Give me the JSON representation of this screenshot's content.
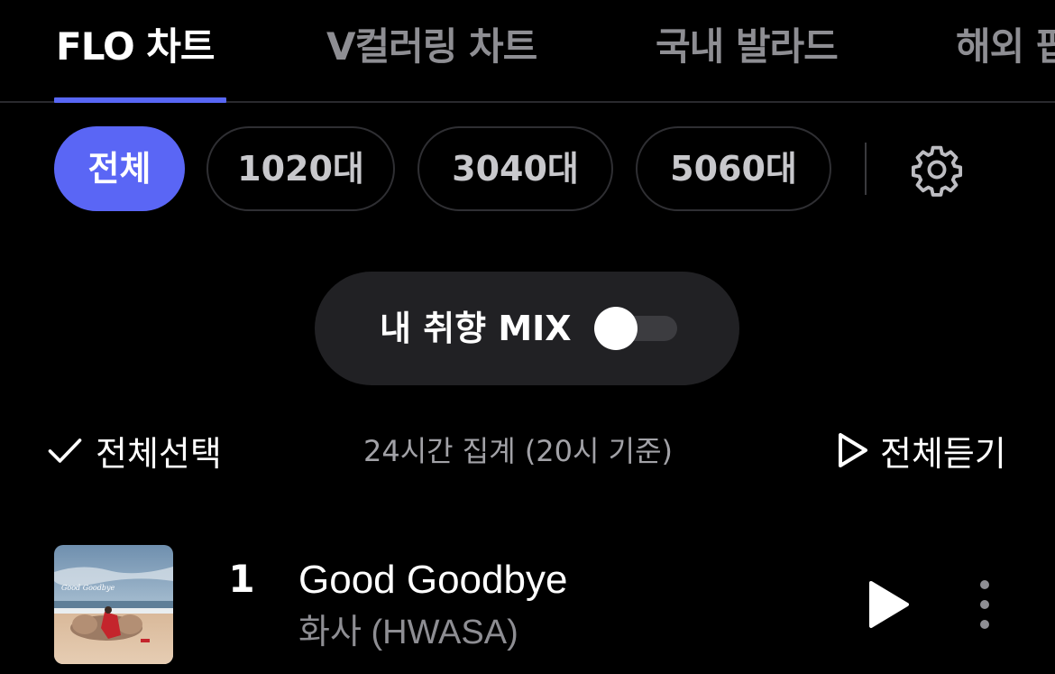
{
  "tabs": [
    {
      "label": "FLO 차트",
      "active": true
    },
    {
      "label": "V컬러링 차트",
      "active": false
    },
    {
      "label": "국내 발라드",
      "active": false
    },
    {
      "label": "해외 팝",
      "active": false
    }
  ],
  "filters": [
    {
      "label": "전체",
      "active": true
    },
    {
      "label": "1020대",
      "active": false
    },
    {
      "label": "3040대",
      "active": false
    },
    {
      "label": "5060대",
      "active": false
    }
  ],
  "settings_icon": "gear-icon",
  "mix": {
    "label": "내 취향 MIX",
    "enabled": false
  },
  "actions": {
    "select_all": "전체선택",
    "aggregate_info": "24시간 집계 (20시 기준)",
    "play_all": "전체듣기"
  },
  "tracks": [
    {
      "rank": "1",
      "title": "Good Goodbye",
      "artist": "화사 (HWASA)"
    }
  ],
  "colors": {
    "accent": "#5a66f5",
    "background": "#000000",
    "pill": "#212124",
    "muted_text": "#8e8e93"
  }
}
